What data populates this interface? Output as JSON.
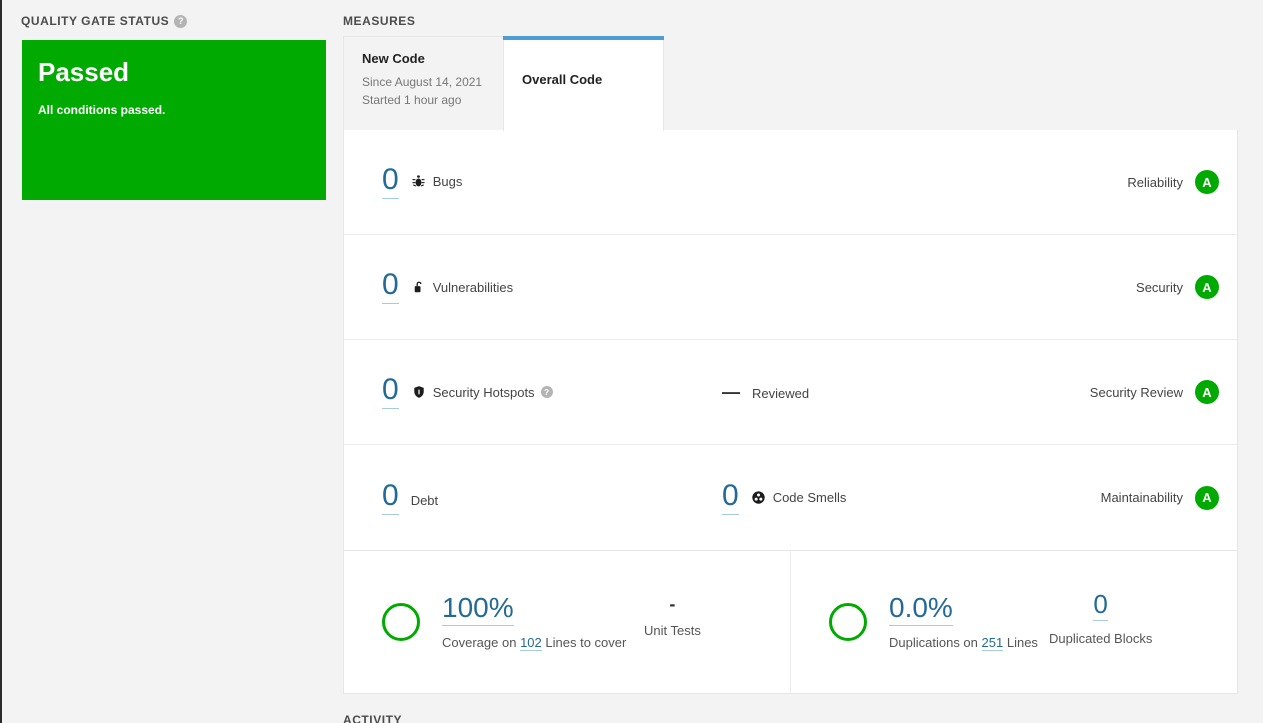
{
  "quality_gate": {
    "heading": "QUALITY GATE STATUS",
    "help_icon": "help-icon",
    "status": "Passed",
    "description": "All conditions passed.",
    "panel_color": "#00aa00"
  },
  "measures": {
    "heading": "MEASURES",
    "tabs": [
      {
        "label": "New Code",
        "since": "Since August 14, 2021",
        "started": "Started 1 hour ago",
        "active": false
      },
      {
        "label": "Overall Code",
        "active": true
      }
    ],
    "accent_color": "#4b9fd5",
    "rows": [
      {
        "value": "0",
        "icon": "bug-icon",
        "label": "Bugs",
        "rating_label": "Reliability",
        "rating": "A",
        "rating_color": "#00aa00"
      },
      {
        "value": "0",
        "icon": "vulnerability-lock-icon",
        "label": "Vulnerabilities",
        "rating_label": "Security",
        "rating": "A",
        "rating_color": "#00aa00"
      },
      {
        "value": "0",
        "icon": "shield-icon",
        "label": "Security Hotspots",
        "has_help": true,
        "secondary_value": "—",
        "secondary_label": "Reviewed",
        "rating_label": "Security Review",
        "rating": "A",
        "rating_color": "#00aa00"
      },
      {
        "value": "0",
        "label": "Debt",
        "secondary_value": "0",
        "secondary_icon": "code-smell-icon",
        "secondary_label": "Code Smells",
        "rating_label": "Maintainability",
        "rating": "A",
        "rating_color": "#00aa00"
      }
    ],
    "coverage": {
      "percent": "100%",
      "prefix": "Coverage on",
      "lines": "102",
      "suffix": "Lines to cover",
      "donut_color": "#00aa00",
      "unit_tests_value": "-",
      "unit_tests_label": "Unit Tests"
    },
    "duplications": {
      "percent": "0.0%",
      "prefix": "Duplications on",
      "lines": "251",
      "suffix": "Lines",
      "donut_color": "#00aa00",
      "blocks_value": "0",
      "blocks_label": "Duplicated Blocks"
    }
  },
  "activity": {
    "heading": "ACTIVITY"
  }
}
